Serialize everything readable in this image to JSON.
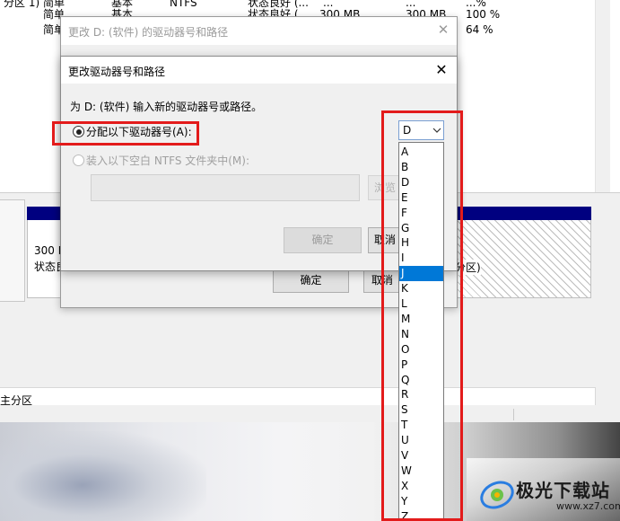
{
  "background_window": {
    "rows": [
      {
        "col1": "分区 1)",
        "col2": "简单",
        "col3": "基本",
        "col4": "NTFS",
        "col5": "状态良好 (...",
        "col6": "...",
        "col7": "...",
        "col8": "...%"
      },
      {
        "col1": "",
        "col2": "简单",
        "col3": "基本",
        "col4": "",
        "col5": "状态良好 (...",
        "col6": "300 MB",
        "col7": "300 MB",
        "col8": "100 %"
      },
      {
        "col1": "",
        "col2": "简单",
        "col3": "",
        "col4": "",
        "col5": "",
        "col6": "",
        "col7": "",
        "col8": "64 %"
      }
    ],
    "volume_1_size": "300 M",
    "volume_1_status": "状态良",
    "volume_2_text": "分区)",
    "legend_text": "主分区"
  },
  "outer_dialog": {
    "title": "更改 D: (软件) 的驱动器号和路径",
    "ok_label": "确定",
    "cancel_label": "取消"
  },
  "inner_dialog": {
    "title": "更改驱动器号和路径",
    "instruction": "为 D: (软件) 输入新的驱动器号或路径。",
    "assign_option_label": "分配以下驱动器号(A):",
    "mount_option_label": "装入以下空白 NTFS 文件夹中(M):",
    "mount_path_value": "",
    "browse_label": "浏览",
    "ok_label": "确定",
    "cancel_label": "取消",
    "selected_letter": "D",
    "letters": [
      "A",
      "B",
      "D",
      "E",
      "F",
      "G",
      "H",
      "I",
      "J",
      "K",
      "L",
      "M",
      "N",
      "O",
      "P",
      "Q",
      "R",
      "S",
      "T",
      "U",
      "V",
      "W",
      "X",
      "Y",
      "Z"
    ],
    "highlighted_letter": "J"
  },
  "watermark": {
    "brand": "极光下载站",
    "url": "www.xz7.com"
  },
  "colors": {
    "annotation_red": "#e31b1b",
    "selection_blue": "#0078d7",
    "volume_bar_navy": "#000080"
  },
  "icons": {
    "close": "close-icon",
    "dropdown_arrow": "chevron-down-icon",
    "watermark_logo": "aurora-logo-icon"
  }
}
